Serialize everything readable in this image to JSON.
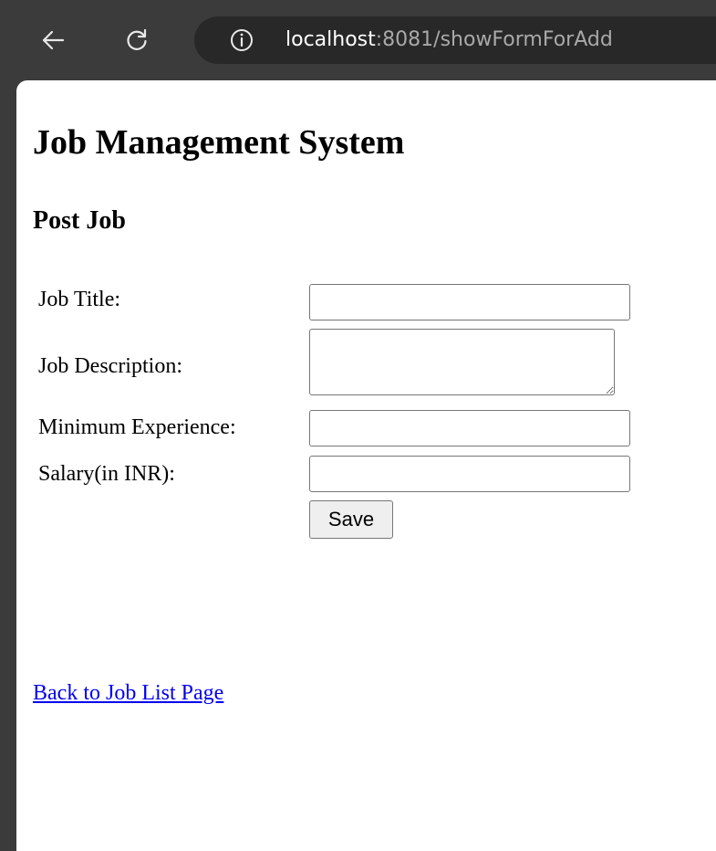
{
  "browser": {
    "url_host": "localhost",
    "url_path": ":8081/showFormForAdd",
    "icons": {
      "back": "back-arrow-icon",
      "reload": "reload-icon",
      "info": "info-icon"
    }
  },
  "page": {
    "title": "Job Management System",
    "section_title": "Post Job"
  },
  "form": {
    "job_title": {
      "label": "Job Title:",
      "value": ""
    },
    "job_description": {
      "label": "Job Description:",
      "value": ""
    },
    "min_experience": {
      "label": "Minimum Experience:",
      "value": ""
    },
    "salary": {
      "label": "Salary(in INR):",
      "value": ""
    },
    "save_label": "Save"
  },
  "footer": {
    "back_link": "Back to Job List Page"
  },
  "colors": {
    "chrome_bg": "#3b3b3b",
    "address_bg": "#282828",
    "link": "#0000ee"
  }
}
